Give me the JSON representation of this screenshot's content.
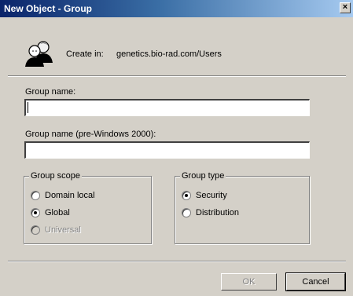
{
  "window": {
    "title": "New Object - Group",
    "close_glyph": "×"
  },
  "header": {
    "icon": "users-icon",
    "create_in_label": "Create in:",
    "create_in_path": "genetics.bio-rad.com/Users"
  },
  "form": {
    "group_name_label": "Group name:",
    "group_name_value": "",
    "pre2000_label": "Group name (pre-Windows 2000):",
    "pre2000_value": ""
  },
  "group_scope": {
    "legend": "Group scope",
    "options": [
      {
        "label": "Domain local",
        "checked": false,
        "disabled": false
      },
      {
        "label": "Global",
        "checked": true,
        "disabled": false
      },
      {
        "label": "Universal",
        "checked": false,
        "disabled": true
      }
    ]
  },
  "group_type": {
    "legend": "Group type",
    "options": [
      {
        "label": "Security",
        "checked": true,
        "disabled": false
      },
      {
        "label": "Distribution",
        "checked": false,
        "disabled": false
      }
    ]
  },
  "buttons": {
    "ok": "OK",
    "cancel": "Cancel",
    "ok_disabled": true
  }
}
